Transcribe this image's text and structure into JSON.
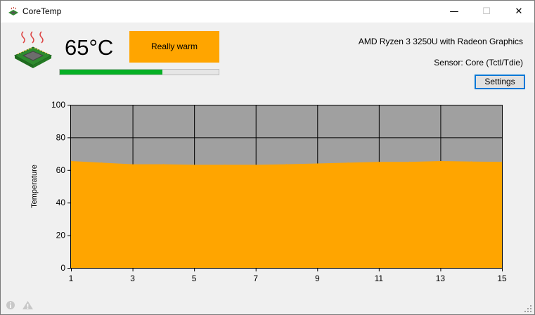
{
  "window": {
    "title": "CoreTemp",
    "minimize": "—",
    "maximize": "☐",
    "close": "✕"
  },
  "temperature": {
    "value": "65°C",
    "status": "Really warm",
    "level_fraction": 0.645
  },
  "cpu": {
    "name": "AMD Ryzen 3 3250U with Radeon Graphics",
    "sensor": "Sensor: Core (Tctl/Tdie)"
  },
  "settings_label": "Settings",
  "icons": {
    "app": "cpu-chip-icon",
    "logo": "hot-cpu-icon",
    "info": "info-icon",
    "warning": "warning-icon",
    "grip": "resize-grip-icon"
  },
  "colors": {
    "accent": "#ffa500",
    "progress": "#06b025",
    "chart_bg": "#a0a0a0",
    "button_border": "#0078d7"
  },
  "chart_data": {
    "type": "area",
    "ylabel": "Temperature",
    "xlabel": "",
    "x": [
      1,
      2,
      3,
      4,
      5,
      6,
      7,
      8,
      9,
      10,
      11,
      12,
      13,
      14,
      15
    ],
    "values": [
      65.5,
      64.5,
      63.5,
      63.5,
      63.2,
      63.2,
      63.2,
      63.5,
      64,
      64.5,
      65,
      65,
      65.5,
      65.2,
      65
    ],
    "xticks": [
      1,
      3,
      5,
      7,
      9,
      11,
      13,
      15
    ],
    "yticks": [
      0,
      20,
      40,
      60,
      80,
      100
    ],
    "xlim": [
      1,
      15
    ],
    "ylim": [
      0,
      100
    ],
    "grid": true,
    "fill_color": "#ffa500",
    "background_color": "#a0a0a0"
  }
}
